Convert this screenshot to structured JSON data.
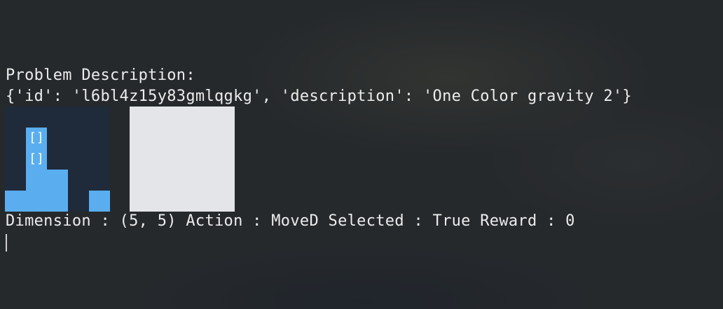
{
  "terminal": {
    "title": "Problem Description:",
    "problem_line": "{'id': 'l6bl4z15y83gmlqgkg', 'description': 'One Color gravity 2'}",
    "status_line": "Dimension : (5, 5) Action : MoveD Selected : True Reward : 0"
  },
  "current_grid": {
    "rows": 5,
    "cols": 5,
    "empty_color": "#1f2a3a",
    "fill_color": "#5aaef0",
    "selected_marker": "[]",
    "cells": [
      {
        "row": 1,
        "col": 1,
        "state": "selected"
      },
      {
        "row": 2,
        "col": 1,
        "state": "selected"
      },
      {
        "row": 3,
        "col": 1,
        "state": "filled"
      },
      {
        "row": 3,
        "col": 2,
        "state": "filled"
      },
      {
        "row": 4,
        "col": 0,
        "state": "filled"
      },
      {
        "row": 4,
        "col": 1,
        "state": "filled"
      },
      {
        "row": 4,
        "col": 2,
        "state": "filled"
      },
      {
        "row": 4,
        "col": 4,
        "state": "filled"
      }
    ]
  },
  "target_grid": {
    "rows": 5,
    "cols": 5,
    "fill_color": "#e3e5e8"
  },
  "colors": {
    "background": "#26292c",
    "text": "#ececec",
    "cell_blue": "#5aaef0"
  }
}
